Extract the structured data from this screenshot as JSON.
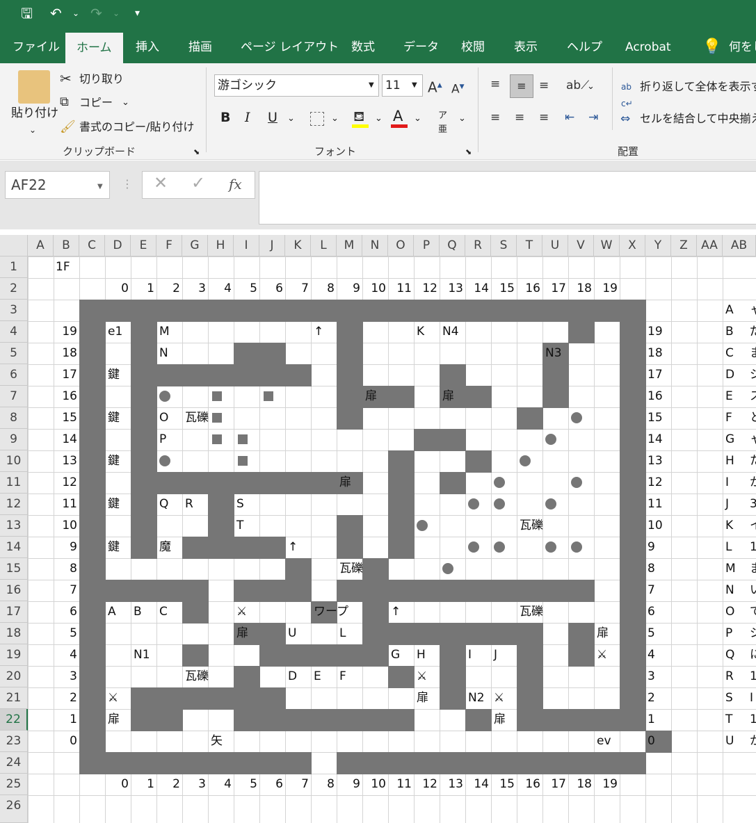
{
  "app": {
    "accent": "#217346",
    "wall_color": "#767676"
  },
  "quick_access": {
    "save_icon": "save-icon",
    "undo_icon": "undo-icon",
    "redo_icon": "redo-icon",
    "customize_icon": "customize-icon"
  },
  "tabs": [
    "ファイル",
    "ホーム",
    "挿入",
    "描画",
    "ページ レイアウト",
    "数式",
    "データ",
    "校閲",
    "表示",
    "ヘルプ",
    "Acrobat",
    "何をし"
  ],
  "ribbon": {
    "clipboard": {
      "paste": "貼り付け",
      "cut": "切り取り",
      "copy": "コピー",
      "format_painter": "書式のコピー/貼り付け",
      "label": "クリップボード"
    },
    "font": {
      "name": "游ゴシック",
      "size": "11",
      "bold": "B",
      "italic": "I",
      "underline": "U",
      "label": "フォント"
    },
    "alignment": {
      "wrap": "折り返して全体を表示す",
      "merge": "セルを結合して中央揃え",
      "label": "配置"
    }
  },
  "namebox": "AF22",
  "fx": "fx",
  "columns": [
    "A",
    "B",
    "C",
    "D",
    "E",
    "F",
    "G",
    "H",
    "I",
    "J",
    "K",
    "L",
    "M",
    "N",
    "O",
    "P",
    "Q",
    "R",
    "S",
    "T",
    "U",
    "V",
    "W",
    "X",
    "Y",
    "Z",
    "AA",
    "AB"
  ],
  "rows": [
    "1",
    "2",
    "3",
    "4",
    "5",
    "6",
    "7",
    "8",
    "9",
    "10",
    "11",
    "12",
    "13",
    "14",
    "15",
    "16",
    "17",
    "18",
    "19",
    "20",
    "21",
    "22",
    "23",
    "24",
    "25",
    "26"
  ],
  "grid": {
    "floor": "1F",
    "x_axis": [
      "0",
      "1",
      "2",
      "3",
      "4",
      "5",
      "6",
      "7",
      "8",
      "9",
      "10",
      "11",
      "12",
      "13",
      "14",
      "15",
      "16",
      "17",
      "18",
      "19"
    ],
    "y_axis": [
      "19",
      "18",
      "17",
      "16",
      "15",
      "14",
      "13",
      "12",
      "11",
      "10",
      "9",
      "8",
      "7",
      "6",
      "5",
      "4",
      "3",
      "2",
      "1",
      "0"
    ],
    "walls": [
      "CCCCCCCCCCCCCCCCCCCCCC",
      "C.C.......C........C.C",
      "C.C...CC..C.......C..C",
      "C.CCCCCCC.C...C...C..C",
      "C.C.......CCC.CC..C..C",
      "C.C.......C......C...C",
      "C.C..........CC......C",
      "C.C.........C..C.....C",
      "C.CCCCCCCCC.C.C......C",
      "C.C..C......C........C",
      "C.C..C....C.C........C",
      "C.C.CCCC..C.C........C",
      "C.......C..C.........C",
      "CCCCC.CCC.CCCCCCCCCC.C",
      "C...C....C.C.........C",
      "C.....CC...CCCCCCC.C.C",
      "C...C..CCCCC..C..C.C.C",
      "C.....C.....C.C..C...C",
      "C.CCCCCC......C..C...C",
      "C.CC..CCCCCCC..C.CCCCC",
      "C.....................C",
      "CCCCCCCCC.CCCCCCCCCCCC"
    ],
    "labels": [
      {
        "r": 4,
        "c": 3,
        "t": "e1"
      },
      {
        "r": 4,
        "c": 5,
        "t": "M"
      },
      {
        "r": 4,
        "c": 11,
        "t": "↑"
      },
      {
        "r": 4,
        "c": 15,
        "t": "K"
      },
      {
        "r": 4,
        "c": 16,
        "t": "N4"
      },
      {
        "r": 5,
        "c": 5,
        "t": "N"
      },
      {
        "r": 5,
        "c": 20,
        "t": "N3"
      },
      {
        "r": 6,
        "c": 3,
        "t": "鍵"
      },
      {
        "r": 7,
        "c": 13,
        "t": "扉"
      },
      {
        "r": 7,
        "c": 16,
        "t": "扉"
      },
      {
        "r": 8,
        "c": 3,
        "t": "鍵"
      },
      {
        "r": 8,
        "c": 5,
        "t": "O"
      },
      {
        "r": 8,
        "c": 6,
        "t": "瓦礫"
      },
      {
        "r": 9,
        "c": 5,
        "t": "P"
      },
      {
        "r": 10,
        "c": 3,
        "t": "鍵"
      },
      {
        "r": 11,
        "c": 12,
        "t": "扉"
      },
      {
        "r": 12,
        "c": 3,
        "t": "鍵"
      },
      {
        "r": 12,
        "c": 5,
        "t": "Q"
      },
      {
        "r": 12,
        "c": 6,
        "t": "R"
      },
      {
        "r": 12,
        "c": 8,
        "t": "S"
      },
      {
        "r": 13,
        "c": 8,
        "t": "T"
      },
      {
        "r": 13,
        "c": 19,
        "t": "瓦礫"
      },
      {
        "r": 14,
        "c": 3,
        "t": "鍵"
      },
      {
        "r": 14,
        "c": 5,
        "t": "魔"
      },
      {
        "r": 14,
        "c": 10,
        "t": "↑"
      },
      {
        "r": 15,
        "c": 12,
        "t": "瓦礫"
      },
      {
        "r": 17,
        "c": 3,
        "t": "A"
      },
      {
        "r": 17,
        "c": 4,
        "t": "B"
      },
      {
        "r": 17,
        "c": 5,
        "t": "C"
      },
      {
        "r": 17,
        "c": 8,
        "t": "⚔"
      },
      {
        "r": 17,
        "c": 11,
        "t": "ワープ"
      },
      {
        "r": 17,
        "c": 14,
        "t": "↑"
      },
      {
        "r": 17,
        "c": 19,
        "t": "瓦礫"
      },
      {
        "r": 18,
        "c": 8,
        "t": "扉"
      },
      {
        "r": 18,
        "c": 10,
        "t": "U"
      },
      {
        "r": 18,
        "c": 12,
        "t": "L"
      },
      {
        "r": 18,
        "c": 22,
        "t": "扉"
      },
      {
        "r": 19,
        "c": 4,
        "t": "N1"
      },
      {
        "r": 19,
        "c": 14,
        "t": "G"
      },
      {
        "r": 19,
        "c": 15,
        "t": "H"
      },
      {
        "r": 19,
        "c": 17,
        "t": "I"
      },
      {
        "r": 19,
        "c": 18,
        "t": "J"
      },
      {
        "r": 19,
        "c": 22,
        "t": "⚔"
      },
      {
        "r": 20,
        "c": 6,
        "t": "瓦礫"
      },
      {
        "r": 20,
        "c": 10,
        "t": "D"
      },
      {
        "r": 20,
        "c": 11,
        "t": "E"
      },
      {
        "r": 20,
        "c": 12,
        "t": "F"
      },
      {
        "r": 20,
        "c": 15,
        "t": "⚔"
      },
      {
        "r": 21,
        "c": 3,
        "t": "⚔"
      },
      {
        "r": 21,
        "c": 15,
        "t": "扉"
      },
      {
        "r": 21,
        "c": 17,
        "t": "N2"
      },
      {
        "r": 21,
        "c": 18,
        "t": "⚔"
      },
      {
        "r": 22,
        "c": 3,
        "t": "扉"
      },
      {
        "r": 22,
        "c": 18,
        "t": "扉"
      },
      {
        "r": 23,
        "c": 7,
        "t": "矢"
      },
      {
        "r": 23,
        "c": 22,
        "t": "ev"
      }
    ],
    "dots": [
      [
        7,
        5
      ],
      [
        7,
        20
      ],
      [
        8,
        21
      ],
      [
        9,
        20
      ],
      [
        10,
        5
      ],
      [
        10,
        19
      ],
      [
        11,
        18
      ],
      [
        11,
        21
      ],
      [
        12,
        17
      ],
      [
        12,
        18
      ],
      [
        12,
        20
      ],
      [
        13,
        15
      ],
      [
        14,
        17
      ],
      [
        14,
        18
      ],
      [
        14,
        20
      ],
      [
        14,
        21
      ],
      [
        15,
        16
      ]
    ],
    "squares": [
      [
        7,
        7
      ],
      [
        7,
        9
      ],
      [
        8,
        7
      ],
      [
        9,
        7
      ],
      [
        9,
        8
      ],
      [
        10,
        8
      ]
    ],
    "legend": [
      "A",
      "B",
      "C",
      "D",
      "E",
      "F",
      "G",
      "H",
      "I",
      "J",
      "K",
      "L",
      "M",
      "N",
      "O",
      "P",
      "Q",
      "R",
      "S",
      "T",
      "U"
    ],
    "legend_next": [
      "ャ",
      "だ",
      "ま",
      "ジ",
      "ス",
      "と",
      "ャ",
      "た",
      "か",
      "3",
      "イ",
      "1",
      "ま",
      "い",
      "で",
      "ジ",
      "に",
      "1",
      "I",
      "1",
      "か"
    ]
  }
}
